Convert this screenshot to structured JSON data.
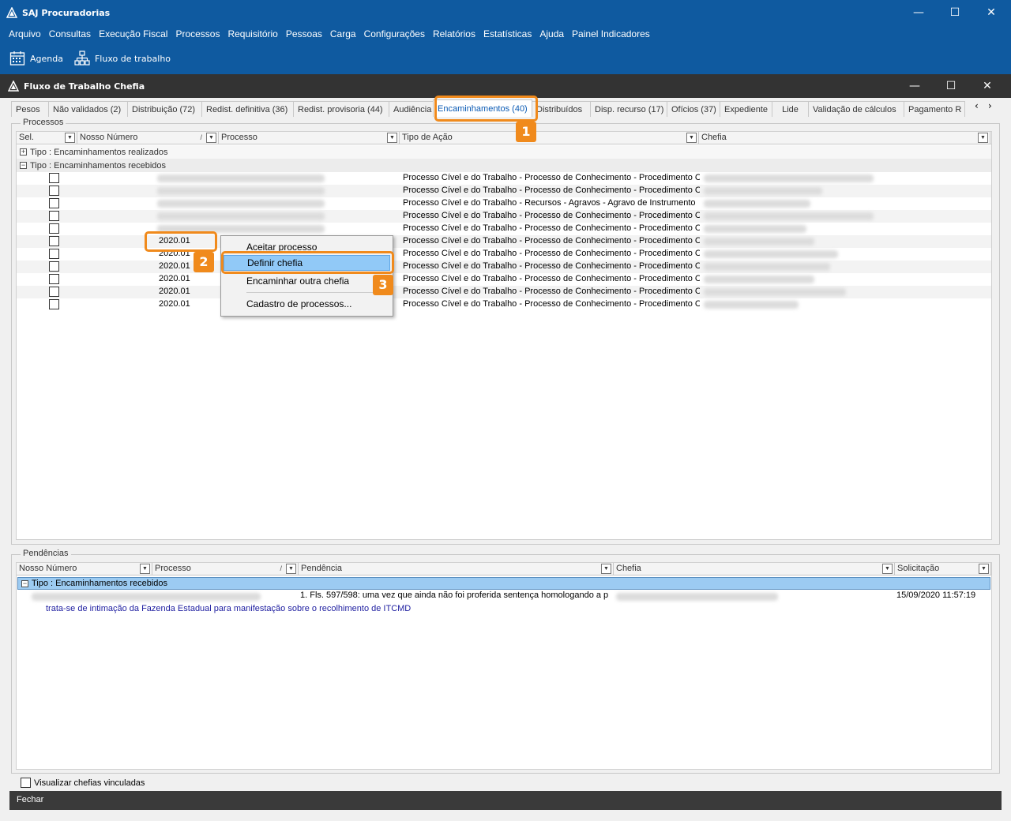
{
  "app": {
    "title": "SAJ Procuradorias",
    "menu": [
      "Arquivo",
      "Consultas",
      "Execução Fiscal",
      "Processos",
      "Requisitório",
      "Pessoas",
      "Carga",
      "Configurações",
      "Relatórios",
      "Estatísticas",
      "Ajuda",
      "Painel Indicadores"
    ],
    "toolbar": {
      "agenda": "Agenda",
      "fluxo": "Fluxo de trabalho"
    }
  },
  "window": {
    "title": "Fluxo de Trabalho Chefia",
    "tabs": [
      "Pesos",
      "Não validados (2)",
      "Distribuição (72)",
      "Redist. definitiva (36)",
      "Redist. provisoria (44)",
      "Audiência",
      "Encaminhamentos (40)",
      "Distribuídos",
      "Disp. recurso (17)",
      "Ofícios (37)",
      "Expediente",
      "Lide",
      "Validação de cálculos",
      "Pagamento R"
    ],
    "active_tab": "Encaminhamentos (40)"
  },
  "processos": {
    "label": "Processos",
    "columns": [
      "Sel.",
      "Nosso Número",
      "Processo",
      "Tipo de Ação",
      "Chefia"
    ],
    "sort_mark": "/",
    "groups": [
      "Tipo : Encaminhamentos realizados",
      "Tipo : Encaminhamentos recebidos"
    ],
    "expanders": [
      "+",
      "−"
    ],
    "rows": [
      {
        "nn": "",
        "tipo": "Processo Cível e do Trabalho - Processo de Conhecimento - Procedimento Comum"
      },
      {
        "nn": "",
        "tipo": "Processo Cível e do Trabalho - Processo de Conhecimento - Procedimento Comum"
      },
      {
        "nn": "",
        "tipo": "Processo Cível e do Trabalho - Recursos - Agravos - Agravo de Instrumento"
      },
      {
        "nn": "",
        "tipo": "Processo Cível e do Trabalho - Processo de Conhecimento - Procedimento Comum"
      },
      {
        "nn": "",
        "tipo": "Processo Cível e do Trabalho - Processo de Conhecimento - Procedimento Comum"
      },
      {
        "nn": "2020.01",
        "tipo": "Processo Cível e do Trabalho - Processo de Conhecimento - Procedimento Comum"
      },
      {
        "nn": "2020.01",
        "tipo": "Processo Cível e do Trabalho - Processo de Conhecimento - Procedimento Comum"
      },
      {
        "nn": "2020.01",
        "tipo": "Processo Cível e do Trabalho - Processo de Conhecimento - Procedimento Comum"
      },
      {
        "nn": "2020.01",
        "tipo": "Processo Cível e do Trabalho - Processo de Conhecimento - Procedimento Comum"
      },
      {
        "nn": "2020.01",
        "tipo": "Processo Cível e do Trabalho - Processo de Conhecimento - Procedimento Comum"
      },
      {
        "nn": "2020.01",
        "tipo": "Processo Cível e do Trabalho - Processo de Conhecimento - Procedimento Comum"
      }
    ]
  },
  "context_menu": {
    "items": [
      "Aceitar processo",
      "Definir chefia",
      "Encaminhar outra chefia",
      "Cadastro de processos..."
    ],
    "highlighted": "Definir chefia"
  },
  "callouts": [
    "1",
    "2",
    "3"
  ],
  "pendencias": {
    "label": "Pendências",
    "columns": [
      "Nosso Número",
      "Processo",
      "Pendência",
      "Chefia",
      "Solicitação"
    ],
    "sort_mark": "/",
    "group": "Tipo : Encaminhamentos recebidos",
    "row": {
      "pendencia": "1. Fls. 597/598: uma vez que ainda não foi proferida sentença homologando a p",
      "solicitacao": "15/09/2020 11:57:19",
      "detail": "trata-se de intimação da Fazenda Estadual para manifestação sobre o recolhimento de ITCMD"
    }
  },
  "footer": {
    "checkbox_label": "Visualizar chefias vinculadas",
    "close_button": "Fechar"
  },
  "colors": {
    "brand": "#0f5aa0",
    "accent": "#f08a1c",
    "highlight": "#91c9f7",
    "link": "#1e1ea0"
  }
}
